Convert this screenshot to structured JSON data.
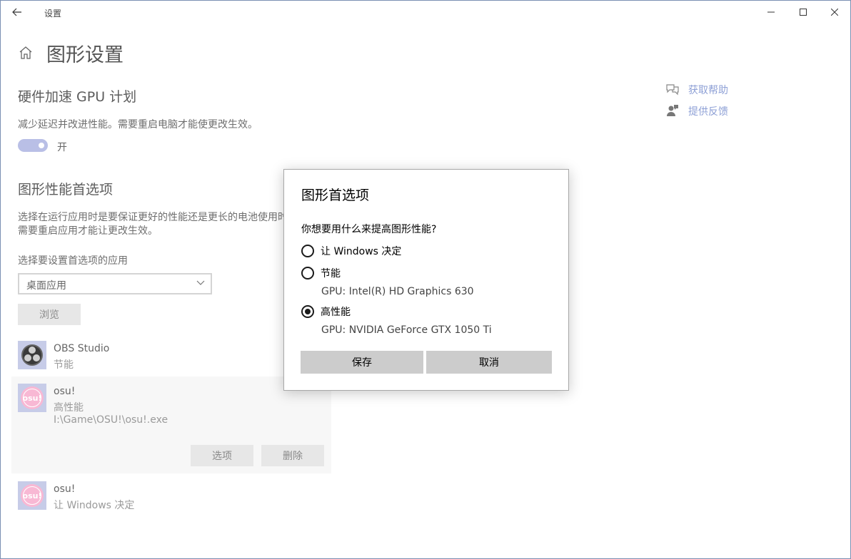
{
  "window": {
    "title": "设置"
  },
  "page": {
    "title": "图形设置"
  },
  "hardware_gpu": {
    "heading": "硬件加速 GPU 计划",
    "description": "减少延迟并改进性能。需要重启电脑才能使更改生效。",
    "toggle_state": "开"
  },
  "graphics_perf": {
    "heading": "图形性能首选项",
    "description_line1": "选择在运行应用时是要保证更好的性能还是更长的电池使用时间",
    "description_line2": "需要重启应用才能让更改生效。",
    "select_label": "选择要设置首选项的应用",
    "select_value": "桌面应用",
    "browse_label": "浏览"
  },
  "apps": [
    {
      "name": "OBS Studio",
      "preference": "节能"
    },
    {
      "name": "osu!",
      "preference": "高性能",
      "path": "I:\\Game\\OSU!\\osu!.exe",
      "options_label": "选项",
      "delete_label": "删除"
    },
    {
      "name": "osu!",
      "preference": "让 Windows 决定"
    }
  ],
  "osu_logo_text": "osu!",
  "help": {
    "get_help": "获取帮助",
    "feedback": "提供反馈"
  },
  "dialog": {
    "title": "图形首选项",
    "question": "你想要用什么来提高图形性能?",
    "options": [
      {
        "label": "让 Windows 决定",
        "sub": "",
        "checked": false
      },
      {
        "label": "节能",
        "sub": "GPU: Intel(R) HD Graphics 630",
        "checked": false
      },
      {
        "label": "高性能",
        "sub": "GPU: NVIDIA GeForce GTX 1050 Ti",
        "checked": true
      }
    ],
    "save_label": "保存",
    "cancel_label": "取消"
  },
  "colors": {
    "accent_link": "#8ea0d6",
    "toggle_on": "#b9bfe6",
    "dialog_button": "#cccccc"
  }
}
